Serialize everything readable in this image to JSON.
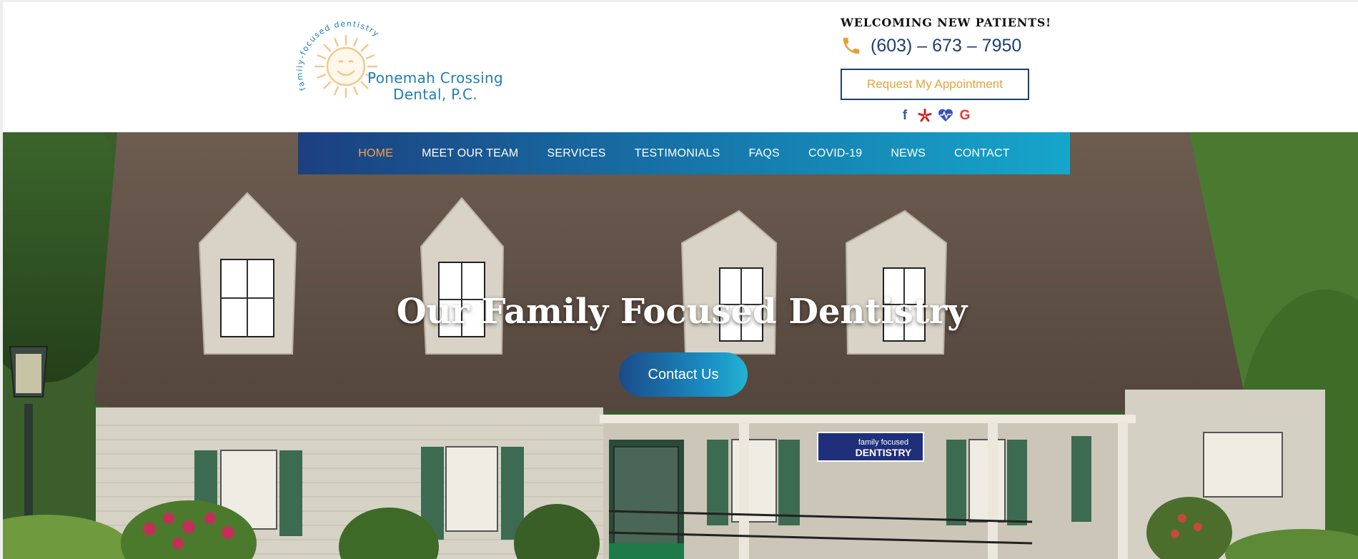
{
  "logo": {
    "arc_text": "family-focused dentistry",
    "name_line1": "Ponemah Crossing",
    "name_line2": "Dental, P.C."
  },
  "header": {
    "welcome": "WELCOMING NEW PATIENTS!",
    "phone": "(603) – 673 – 7950",
    "appointment_button": "Request My Appointment",
    "socials": [
      "facebook-icon",
      "yelp-icon",
      "healthgrades-icon",
      "google-icon"
    ]
  },
  "nav": {
    "items": [
      {
        "label": "HOME",
        "active": true
      },
      {
        "label": "MEET OUR TEAM"
      },
      {
        "label": "SERVICES"
      },
      {
        "label": "TESTIMONIALS"
      },
      {
        "label": "FAQS"
      },
      {
        "label": "COVID-19"
      },
      {
        "label": "NEWS"
      },
      {
        "label": "CONTACT"
      }
    ]
  },
  "hero": {
    "title": "Our Family Focused Dentistry",
    "button": "Contact Us",
    "sign_line1": "family focused",
    "sign_line2": "DENTISTRY"
  },
  "colors": {
    "accent_orange": "#e7a23c",
    "navy": "#1c3f73",
    "logo_blue": "#1f7fb3",
    "nav_gradient_start": "#1c3f80",
    "nav_gradient_end": "#16a6cb"
  }
}
